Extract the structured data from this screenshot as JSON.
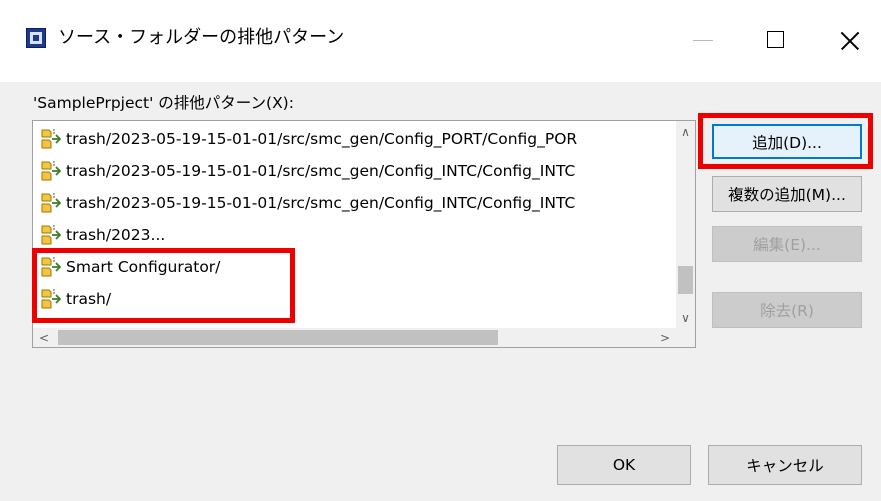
{
  "window": {
    "title": "ソース・フォルダーの排他パターン",
    "app_icon": "ide-app-icon",
    "controls": [
      "minimize-icon",
      "maximize-icon",
      "close-icon"
    ]
  },
  "exclusion_list": {
    "label": "'SamplePrpject' の排他パターン(X):",
    "item_icon": "exclusion-pattern-icon",
    "items": [
      {
        "label": "trash/2023-05-19-15-01-01/src/smc_gen/Config_PORT/Config_POR"
      },
      {
        "label": "trash/2023-05-19-15-01-01/src/smc_gen/Config_INTC/Config_INTC"
      },
      {
        "label": "trash/2023-05-19-15-01-01/src/smc_gen/Config_INTC/Config_INTC"
      },
      {
        "label": "trash/2023..."
      },
      {
        "label": "Smart Configurator/"
      },
      {
        "label": "trash/"
      }
    ],
    "scroll": {
      "up_arrow": "∧",
      "down_arrow": "∨",
      "left_arrow": "<",
      "right_arrow": ">"
    }
  },
  "buttons": {
    "add": "追加(D)...",
    "add_multiple": "複数の追加(M)...",
    "edit": "編集(E)...",
    "remove": "除去(R)",
    "ok": "OK",
    "cancel": "キャンセル"
  },
  "colors": {
    "highlight": "#ee0000",
    "focus": "#0078d7",
    "disabled_text": "#a0a0a0"
  }
}
